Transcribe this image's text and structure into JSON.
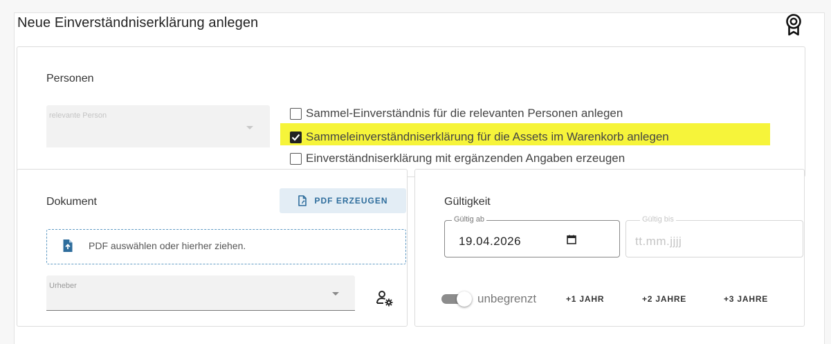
{
  "header": {
    "title": "Neue Einverständniserklärung anlegen",
    "badge_icon": "award-ribbon-icon"
  },
  "personen": {
    "heading": "Personen",
    "person_select": {
      "label": "relevante Person",
      "disabled": true
    },
    "options": [
      {
        "label": "Sammel-Einverständnis für die relevanten Personen anlegen",
        "checked": false
      },
      {
        "label": "Sammeleinverständniserklärung für die Assets im Warenkorb anlegen",
        "checked": true
      },
      {
        "label": "Einverständniserklärung mit ergänzenden Angaben erzeugen",
        "checked": false
      }
    ],
    "highlight_color": "#f6f43a"
  },
  "dokument": {
    "heading": "Dokument",
    "pdf_button": {
      "label": "PDF ERZEUGEN",
      "icon": "file-generate-icon"
    },
    "dropzone": {
      "text": "PDF auswählen oder hierher ziehen.",
      "icon": "file-upload-icon"
    },
    "urheber_select": {
      "label": "Urheber"
    },
    "manage_icon": "user-settings-icon"
  },
  "gueltigkeit": {
    "heading": "Gültigkeit",
    "from": {
      "label": "Gültig ab",
      "value": "19.04.2026",
      "icon": "calendar-icon"
    },
    "to": {
      "label": "Gültig bis",
      "placeholder": "tt.mm.jjjj",
      "disabled": true
    },
    "toggle": {
      "label": "unbegrenzt",
      "on": false
    },
    "quick_buttons": [
      "+1 JAHR",
      "+2 JAHRE",
      "+3 JAHRE"
    ]
  },
  "colors": {
    "accent": "#2e6d9c",
    "button_bg": "#e3edf5",
    "dropzone_border": "#5f9ac4"
  }
}
